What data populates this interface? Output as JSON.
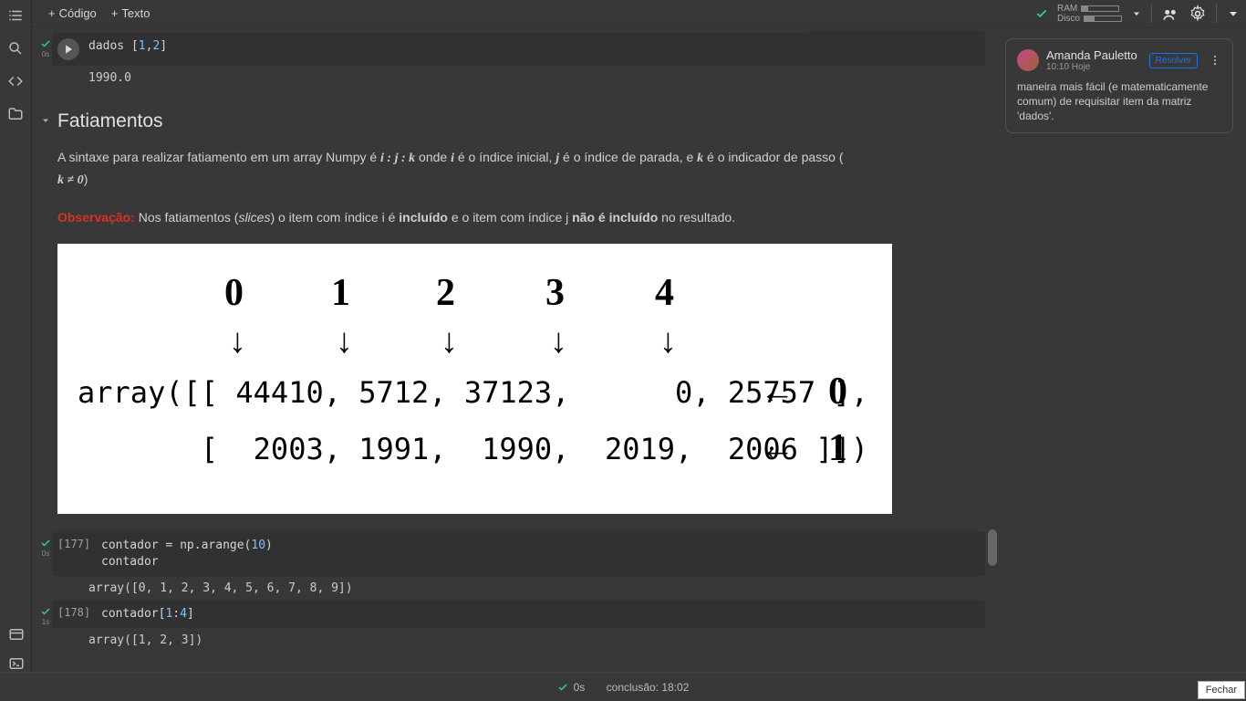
{
  "toolbar": {
    "code_btn": "Código",
    "text_btn": "Texto"
  },
  "resources": {
    "ram_label": "RAM",
    "disk_label": "Disco",
    "ram_pct": 18,
    "disk_pct": 28
  },
  "cell1": {
    "code_prefix": "dados ",
    "code_idx": "[1,2]",
    "exec_time": "0s",
    "output": "1990.0"
  },
  "section": {
    "heading": "Fatiamentos",
    "para1_a": "A sintaxe para realizar fatiamento em um array Numpy é ",
    "para1_m1": "i : j : k",
    "para1_b": " onde ",
    "para1_m2": "i",
    "para1_c": " é o índice inicial, ",
    "para1_m3": "j",
    "para1_d": " é o índice de parada, e ",
    "para1_m4": "k",
    "para1_e": " é o indicador de passo ( ",
    "para1_m5": "k ≠ 0",
    "para1_f": ")",
    "obs_label": "Observação:",
    "obs_a": " Nos fatiamentos (",
    "obs_slices": "slices",
    "obs_b": ") o item com índice i é ",
    "obs_inc": "incluído",
    "obs_c": " e o item com índice j ",
    "obs_notinc": "não é incluído",
    "obs_d": " no resultado."
  },
  "diagram": {
    "col_indices": [
      "0",
      "1",
      "2",
      "3",
      "4"
    ],
    "row0": "array([[ 44410, 5712, 37123,      0, 25757 ],",
    "row1": "       [  2003, 1991,  1990,  2019,  2006 ]])",
    "row_indices": [
      "0",
      "1"
    ]
  },
  "cell2": {
    "exec_num": "[177]",
    "code_line1_a": "contador ",
    "code_line1_b": "= np.arange(",
    "code_line1_num": "10",
    "code_line1_c": ")",
    "code_line2": "contador",
    "exec_time": "0s",
    "output": "array([0, 1, 2, 3, 4, 5, 6, 7, 8, 9])"
  },
  "cell3": {
    "exec_num": "[178]",
    "code_a": "contador[",
    "code_n1": "1",
    "code_colon": ":",
    "code_n2": "4",
    "code_b": "]",
    "exec_time": "1s",
    "output": "array([1, 2, 3])"
  },
  "comment": {
    "user": "Amanda Pauletto",
    "time": "10:10 Hoje",
    "resolve": "Resolver",
    "body": "maneira mais fácil (e matematicamente comum) de requisitar item da matriz 'dados'."
  },
  "status": {
    "time": "0s",
    "label": "conclusão: 18:02"
  },
  "close": "Fechar"
}
